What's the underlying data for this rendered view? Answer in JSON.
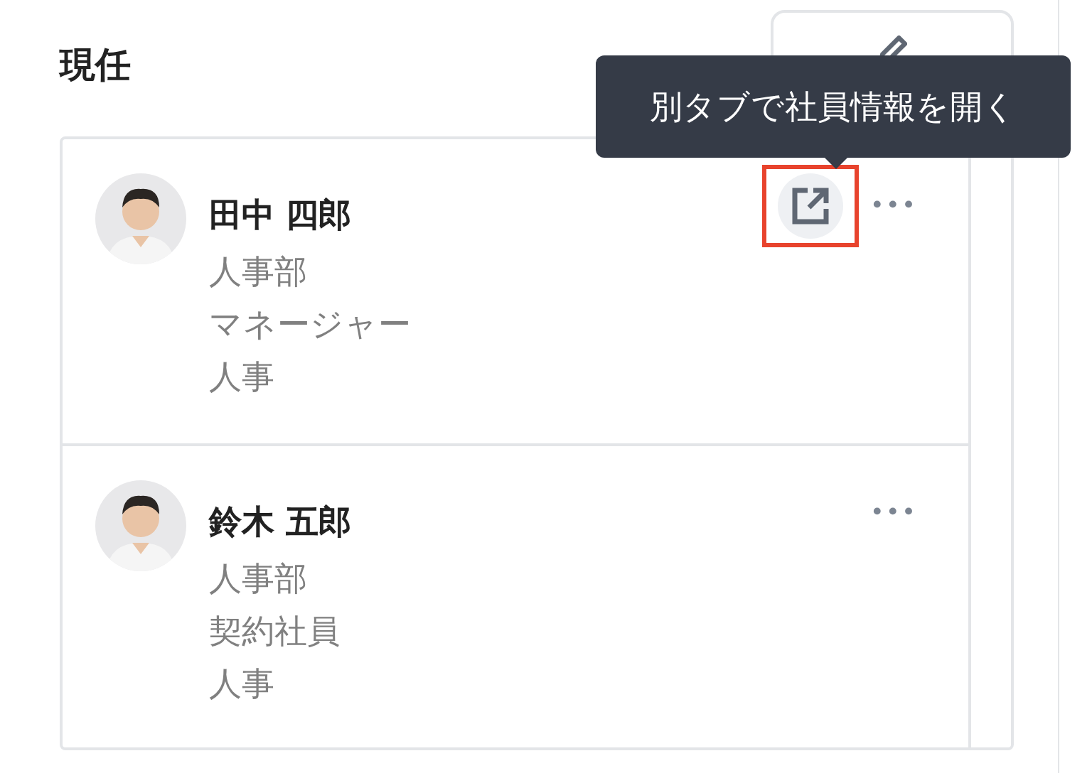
{
  "section": {
    "title": "現任"
  },
  "tooltip": {
    "text": "別タブで社員情報を開く"
  },
  "members": [
    {
      "name": "田中 四郎",
      "lines": [
        "人事部",
        "マネージャー",
        "人事"
      ],
      "open_link_shown": true,
      "highlighted": true,
      "more": "•••"
    },
    {
      "name": "鈴木 五郎",
      "lines": [
        "人事部",
        "契約社員",
        "人事"
      ],
      "open_link_shown": false,
      "highlighted": false,
      "more": "•••"
    }
  ]
}
